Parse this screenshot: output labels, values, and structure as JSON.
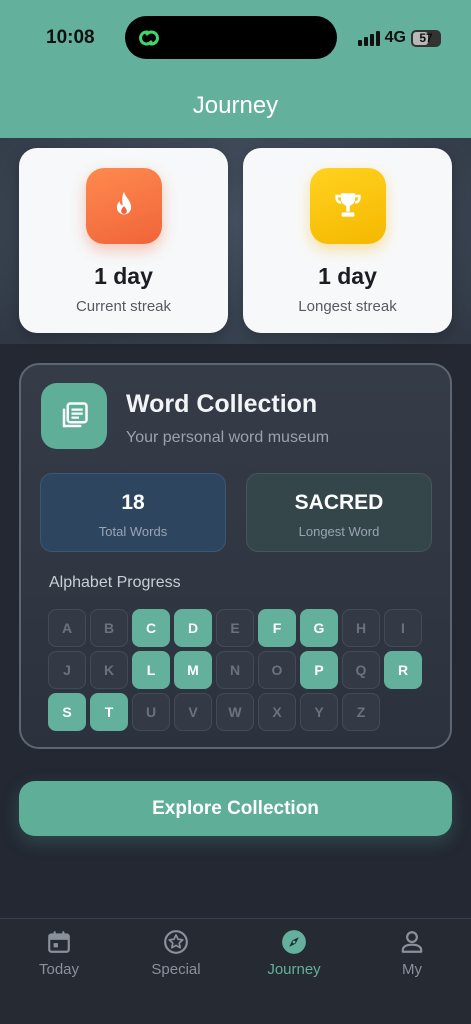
{
  "status": {
    "time": "10:08",
    "network": "4G",
    "battery": "57",
    "battery_level": 0.57
  },
  "header": {
    "title": "Journey"
  },
  "streaks": [
    {
      "value": "1 day",
      "label": "Current streak",
      "icon": "fire-icon",
      "color": "#f0643a"
    },
    {
      "value": "1 day",
      "label": "Longest streak",
      "icon": "trophy-icon",
      "color": "#f5b800"
    }
  ],
  "collection": {
    "title": "Word Collection",
    "subtitle": "Your personal word museum",
    "icon": "library-icon",
    "total_words": "18",
    "total_words_label": "Total Words",
    "longest_word": "SACRED",
    "longest_word_label": "Longest Word"
  },
  "alphabet": {
    "title": "Alphabet Progress",
    "letters": [
      {
        "l": "A",
        "on": false
      },
      {
        "l": "B",
        "on": false
      },
      {
        "l": "C",
        "on": true
      },
      {
        "l": "D",
        "on": true
      },
      {
        "l": "E",
        "on": false
      },
      {
        "l": "F",
        "on": true
      },
      {
        "l": "G",
        "on": true
      },
      {
        "l": "H",
        "on": false
      },
      {
        "l": "I",
        "on": false
      },
      {
        "l": "J",
        "on": false
      },
      {
        "l": "K",
        "on": false
      },
      {
        "l": "L",
        "on": true
      },
      {
        "l": "M",
        "on": true
      },
      {
        "l": "N",
        "on": false
      },
      {
        "l": "O",
        "on": false
      },
      {
        "l": "P",
        "on": true
      },
      {
        "l": "Q",
        "on": false
      },
      {
        "l": "R",
        "on": true
      },
      {
        "l": "S",
        "on": true
      },
      {
        "l": "T",
        "on": true
      },
      {
        "l": "U",
        "on": false
      },
      {
        "l": "V",
        "on": false
      },
      {
        "l": "W",
        "on": false
      },
      {
        "l": "X",
        "on": false
      },
      {
        "l": "Y",
        "on": false
      },
      {
        "l": "Z",
        "on": false
      }
    ]
  },
  "explore_button": {
    "label": "Explore Collection"
  },
  "tabs": [
    {
      "label": "Today",
      "icon": "calendar-icon",
      "active": false
    },
    {
      "label": "Special",
      "icon": "star-badge-icon",
      "active": false
    },
    {
      "label": "Journey",
      "icon": "compass-icon",
      "active": true
    },
    {
      "label": "My",
      "icon": "person-icon",
      "active": false
    }
  ],
  "colors": {
    "accent": "#63b09c",
    "header": "#63b09c",
    "background": "#232833"
  }
}
